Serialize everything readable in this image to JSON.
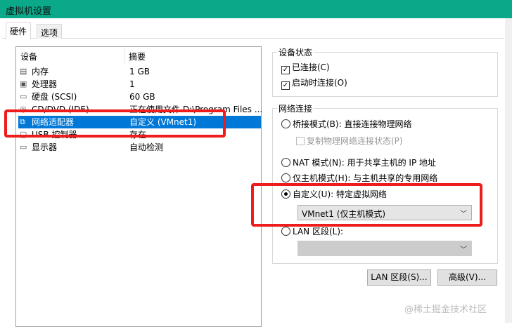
{
  "window": {
    "title": "虚拟机设置"
  },
  "tabs": [
    {
      "label": "硬件"
    },
    {
      "label": "选项"
    }
  ],
  "devices": {
    "headers": [
      "设备",
      "摘要"
    ],
    "rows": [
      {
        "icon": "memory-icon",
        "name": "内存",
        "summary": "1 GB"
      },
      {
        "icon": "cpu-icon",
        "name": "处理器",
        "summary": "1"
      },
      {
        "icon": "disk-icon",
        "name": "硬盘 (SCSI)",
        "summary": "60 GB"
      },
      {
        "icon": "cd-icon",
        "name": "CD/DVD (IDE)",
        "summary": "正在使用文件 D:\\Program Files ..."
      },
      {
        "icon": "network-icon",
        "name": "网络适配器",
        "summary": "自定义 (VMnet1)",
        "selected": true
      },
      {
        "icon": "usb-icon",
        "name": "USB 控制器",
        "summary": "存在"
      },
      {
        "icon": "display-icon",
        "name": "显示器",
        "summary": "自动检测"
      }
    ]
  },
  "device_status": {
    "title": "设备状态",
    "connected": "已连接(C)",
    "connect_on_start": "启动时连接(O)"
  },
  "network": {
    "title": "网络连接",
    "bridged": "桥接模式(B): 直接连接物理网络",
    "replicate": "复制物理网络连接状态(P)",
    "nat": "NAT 模式(N): 用于共享主机的 IP 地址",
    "hostonly": "仅主机模式(H): 与主机共享的专用网络",
    "custom": "自定义(U): 特定虚拟网络",
    "custom_value": "VMnet1 (仅主机模式)",
    "lan": "LAN 区段(L):"
  },
  "buttons": {
    "lan_segments": "LAN 区段(S)...",
    "advanced": "高级(V)..."
  },
  "watermark": "@稀土掘金技术社区",
  "colors": {
    "titlebar": "#0aa98a",
    "selection": "#0078d7",
    "highlight": "#ee1c1c"
  }
}
